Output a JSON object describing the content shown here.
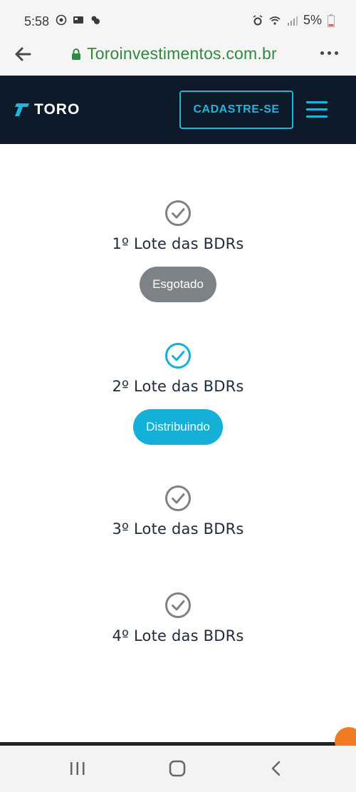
{
  "status_bar": {
    "time": "5:58",
    "battery": "5%",
    "icons": [
      "whatsapp-icon",
      "photo-icon",
      "weather-icon",
      "alarm-icon",
      "wifi-icon",
      "signal-icon",
      "battery-icon"
    ]
  },
  "browser": {
    "url": "Toroinvestimentos.com.br",
    "icons": [
      "back-arrow-icon",
      "lock-icon",
      "more-vert-icon"
    ]
  },
  "header": {
    "logo_text": "TORO",
    "signup_label": "CADASTRE-SE",
    "icons": [
      "toro-logo-icon",
      "hamburger-menu-icon"
    ]
  },
  "lots": [
    {
      "title": "1º Lote das BDRs",
      "status": "Esgotado",
      "status_color": "#7d8287",
      "check_color": "#7d8287"
    },
    {
      "title": "2º Lote das BDRs",
      "status": "Distribuindo",
      "status_color": "#15b0d8",
      "check_color": "#15b0d8"
    },
    {
      "title": "3º Lote das BDRs",
      "check_color": "#7d8287"
    },
    {
      "title": "4º Lote das BDRs",
      "check_color": "#7d8287"
    }
  ],
  "colors": {
    "header_bg": "#0c1a2a",
    "accent": "#26b3d8",
    "url_green": "#2e8b3e"
  },
  "nav_bar": {
    "icons": [
      "recent-apps-icon",
      "home-icon",
      "back-icon"
    ]
  }
}
